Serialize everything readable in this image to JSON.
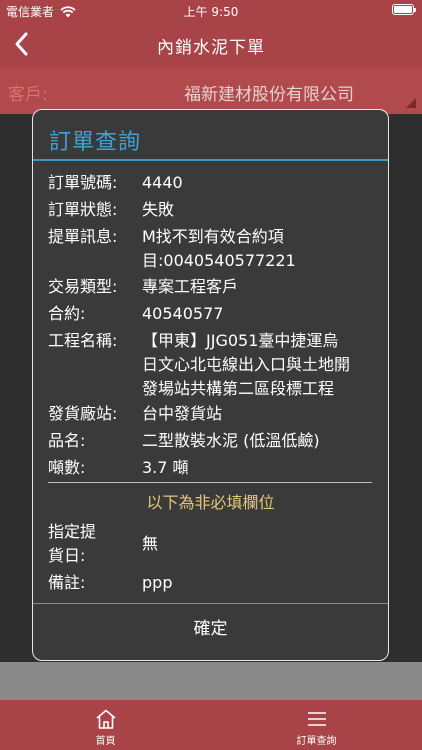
{
  "status_bar": {
    "carrier": "電信業者",
    "time": "上午 9:50"
  },
  "nav": {
    "title": "內銷水泥下單"
  },
  "background_form": {
    "customer_label": "客戶:",
    "customer_value": "福新建材股份有限公司"
  },
  "dialog": {
    "title": "訂單查詢",
    "fields": {
      "order_no": {
        "label": "訂單號碼:",
        "value": "4440"
      },
      "order_status": {
        "label": "訂單狀態:",
        "value": "失敗"
      },
      "message": {
        "label": "提單訊息:",
        "value_line1": "M找不到有效合約項",
        "value_line2": "目:0040540577221"
      },
      "trade_type": {
        "label": "交易類型:",
        "value": "專案工程客戶"
      },
      "contract": {
        "label": "合約:",
        "value": "40540577"
      },
      "project": {
        "label": "工程名稱:",
        "value_line1": "【甲東】JJG051臺中捷運烏",
        "value_line2": "日文心北屯線出入口與土地開",
        "value_line3": "發場站共構第二區段標工程"
      },
      "depot": {
        "label": "發貨廠站:",
        "value": "台中發貨站"
      },
      "product": {
        "label": "品名:",
        "value": "二型散裝水泥 (低溫低鹼)"
      },
      "tonnage": {
        "label": "噸數:",
        "value": "3.7 噸"
      }
    },
    "optional_note": "以下為非必填欄位",
    "optional_fields": {
      "pickup_date": {
        "label_line1": "指定提",
        "label_line2": "貨日:",
        "value": "無"
      },
      "remark": {
        "label": "備註:",
        "value": "ppp"
      }
    },
    "confirm_label": "確定"
  },
  "tabbar": {
    "home_label": "首頁",
    "orders_label": "訂單查詢"
  },
  "colors": {
    "brand_red": "#a84347",
    "title_blue": "#3fa2d2",
    "note_gold": "#e3c77a"
  },
  "icons": {
    "back": "chevron-left-icon",
    "home": "home-icon",
    "orders": "menu-icon",
    "wifi": "wifi-icon",
    "battery": "battery-icon"
  }
}
